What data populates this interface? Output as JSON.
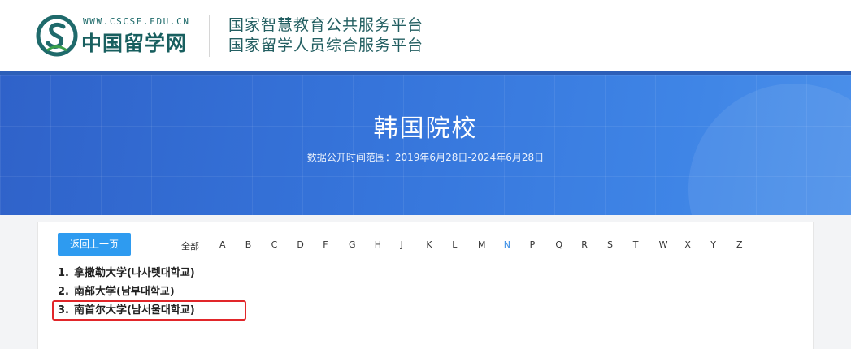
{
  "header": {
    "logo_url": "WWW.CSCSE.EDU.CN",
    "logo_text": "中国留学网",
    "title_line1": "国家智慧教育公共服务平台",
    "title_line2": "国家留学人员综合服务平台"
  },
  "banner": {
    "title": "韩国院校",
    "subtitle": "数据公开时间范围：2019年6月28日-2024年6月28日"
  },
  "filter": {
    "back_label": "返回上一页",
    "all_label": "全部",
    "letters": [
      "A",
      "B",
      "C",
      "D",
      "F",
      "G",
      "H",
      "J",
      "K",
      "L",
      "M",
      "N",
      "P",
      "Q",
      "R",
      "S",
      "T",
      "W",
      "X",
      "Y",
      "Z"
    ],
    "active_letter": "N"
  },
  "universities": [
    {
      "num": "1.",
      "name": "拿撒勒大学(나사렛대학교)"
    },
    {
      "num": "2.",
      "name": "南部大学(남부대학교)"
    },
    {
      "num": "3.",
      "name": "南首尔大学(남서울대학교)"
    }
  ],
  "colors": {
    "accent": "#2e9bf0",
    "banner": "#3675db",
    "highlight": "#e1262a",
    "active_letter": "#3a8ee6"
  }
}
